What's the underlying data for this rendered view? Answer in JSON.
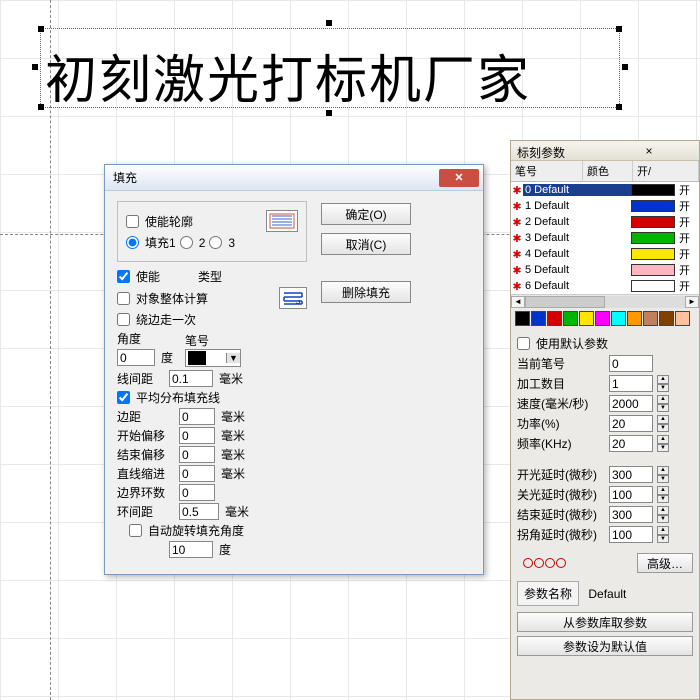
{
  "canvas": {
    "text": "初刻激光打标机厂家"
  },
  "dialog": {
    "title": "填充",
    "enable_outline": "使能轮廓",
    "fill1": "填充1",
    "enable": "使能",
    "type": "类型",
    "whole_calc": "对象整体计算",
    "walk_once": "绕边走一次",
    "angle": "角度",
    "angle_val": "0",
    "deg": "度",
    "pen_no": "笔号",
    "line_dist": "线间距",
    "line_dist_val": "0.1",
    "mm": "毫米",
    "avg_fill": "平均分布填充线",
    "margin": "边距",
    "margin_val": "0",
    "start_off": "开始偏移",
    "start_off_val": "0",
    "end_off": "结束偏移",
    "end_off_val": "0",
    "line_shrink": "直线缩进",
    "line_shrink_val": "0",
    "edge_loops": "边界环数",
    "edge_loops_val": "0",
    "ring_dist": "环间距",
    "ring_dist_val": "0.5",
    "auto_rot": "自动旋转填充角度",
    "auto_rot_val": "10",
    "ok": "确定(O)",
    "cancel": "取消(C)",
    "del_fill": "删除填充"
  },
  "panel": {
    "title": "标刻参数",
    "col_pen": "笔号",
    "col_color": "颜色",
    "col_on": "开/",
    "pens": [
      {
        "label": "0 Default",
        "color": "#000000",
        "on": "开",
        "sel": true
      },
      {
        "label": "1 Default",
        "color": "#0033cc",
        "on": "开"
      },
      {
        "label": "2 Default",
        "color": "#d40000",
        "on": "开"
      },
      {
        "label": "3 Default",
        "color": "#00b400",
        "on": "开"
      },
      {
        "label": "4 Default",
        "color": "#ffe600",
        "on": "开"
      },
      {
        "label": "5 Default",
        "color": "#ffb6c1",
        "on": "开"
      },
      {
        "label": "6 Default",
        "color": "#ffffff",
        "on": "开"
      }
    ],
    "palette": [
      "#000000",
      "#0033cc",
      "#d40000",
      "#00b400",
      "#ffe600",
      "#ff00ff",
      "#00ffff",
      "#ff9900",
      "#c08060",
      "#804000",
      "#ffc0a0"
    ],
    "use_default": "使用默认参数",
    "cur_pen": "当前笔号",
    "cur_pen_val": "0",
    "count": "加工数目",
    "count_val": "1",
    "speed": "速度(毫米/秒)",
    "speed_val": "2000",
    "power": "功率(%)",
    "power_val": "20",
    "freq": "频率(KHz)",
    "freq_val": "20",
    "on_delay": "开光延时(微秒)",
    "on_delay_val": "300",
    "off_delay": "关光延时(微秒)",
    "off_delay_val": "100",
    "end_delay": "结束延时(微秒)",
    "end_delay_val": "300",
    "corner_delay": "拐角延时(微秒)",
    "corner_delay_val": "100",
    "advanced": "高级…",
    "param_name": "参数名称",
    "param_name_val": "Default",
    "from_lib": "从参数库取参数",
    "set_default": "参数设为默认值"
  }
}
